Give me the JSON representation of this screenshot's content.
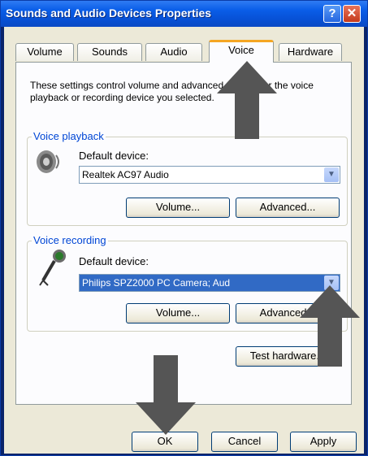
{
  "window": {
    "title": "Sounds and Audio Devices Properties",
    "help": "?",
    "close": "✕"
  },
  "tabs": [
    {
      "label": "Volume"
    },
    {
      "label": "Sounds"
    },
    {
      "label": "Audio"
    },
    {
      "label": "Voice"
    },
    {
      "label": "Hardware"
    }
  ],
  "description": "These settings control volume and advanced options for the voice playback or recording device you selected.",
  "playback": {
    "title": "Voice playback",
    "device_label": "Default device:",
    "device_value": "Realtek AC97 Audio",
    "volume_label": "Volume...",
    "advanced_label": "Advanced..."
  },
  "recording": {
    "title": "Voice recording",
    "device_label": "Default device:",
    "device_value": "Philips SPZ2000 PC Camera; Aud",
    "volume_label": "Volume...",
    "advanced_label": "Advanced..."
  },
  "test_label": "Test hardware...",
  "footer": {
    "ok": "OK",
    "cancel": "Cancel",
    "apply": "Apply"
  },
  "colors": {
    "accent": "#0046d5",
    "titlebar": "#0a5ee8",
    "selection": "#316ac5",
    "arrow": "#555555"
  }
}
